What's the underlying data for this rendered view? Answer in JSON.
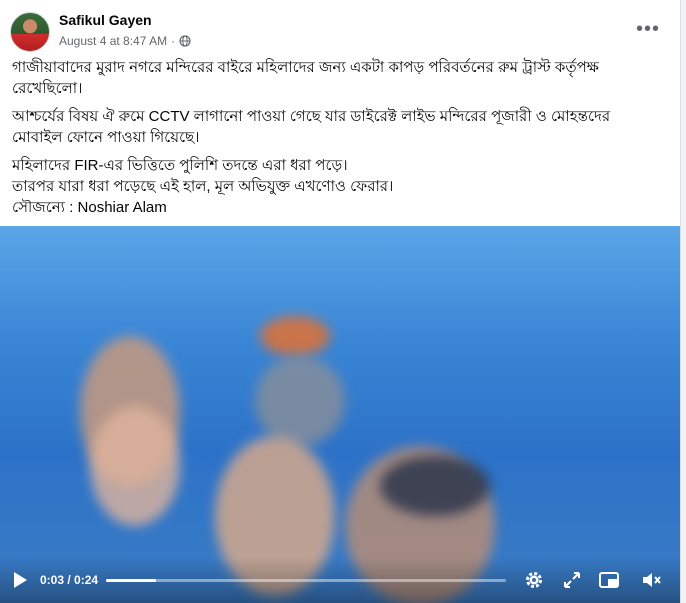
{
  "post": {
    "author": "Safikul Gayen",
    "timestamp": "August 4 at 8:47 AM",
    "separator": "·",
    "audience_icon": "globe-icon",
    "more_icon": "more-options-icon",
    "more_label": "•••",
    "text": {
      "p1_line1": "গাজীয়াবাদের মুরাদ নগরে মন্দিরের বাইরে মহিলাদের জন্য একটা কাপড় পরিবর্তনের রুম ট্রাস্ট কর্তৃপক্ষ",
      "p1_line2": "রেখেছিলো।",
      "p2_line1": "আশ্চর্যের বিষয় ঐ রুমে CCTV লাগানো পাওয়া গেছে যার ডাইরেক্ট লাইভ মন্দিরের পূজারী ও মোহন্তদের",
      "p2_line2": "মোবাইল ফোনে পাওয়া গিয়েছে।",
      "p3_line1": "মহিলাদের FIR-এর ভিত্তিতে পুলিশি তদন্তে এরা ধরা পড়ে।",
      "p3_line2": "তারপর যারা ধরা পড়েছে এই হাল, মূল অভিযুক্ত এখণোও ফেরার।",
      "p3_line3": "সৌজন্যে : Noshiar Alam"
    }
  },
  "video": {
    "current_time": "0:03",
    "duration": "0:24",
    "time_display": "0:03 / 0:24",
    "progress_fraction": 0.125,
    "icons": [
      "play-icon",
      "settings-icon",
      "fullscreen-icon",
      "picture-in-picture-icon",
      "mute-icon"
    ]
  },
  "colors": {
    "text_primary": "#050505",
    "text_secondary": "#65676b",
    "video_blue": "#3a86d6"
  }
}
